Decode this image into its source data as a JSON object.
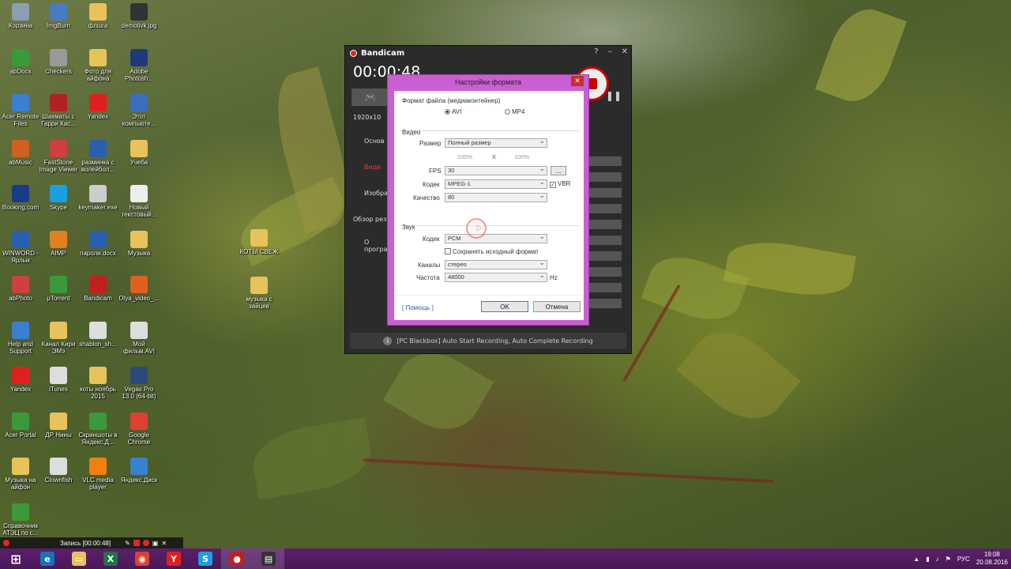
{
  "desktop_icons": [
    {
      "label": "Корзина",
      "icon": "recycle-bin-icon",
      "color": "#8aa0b0"
    },
    {
      "label": "ImgBurn",
      "icon": "imgburn-icon",
      "color": "#4a7bbf"
    },
    {
      "label": "флшга",
      "icon": "folder-icon",
      "color": "#e8c25a"
    },
    {
      "label": "demotivk.jpg",
      "icon": "image-file-icon",
      "color": "#333333"
    },
    {
      "label": "abDocs",
      "icon": "app-icon",
      "color": "#3a9a3a"
    },
    {
      "label": "Checkers",
      "icon": "checkers-icon",
      "color": "#999999"
    },
    {
      "label": "Фото для айфона",
      "icon": "folder-icon",
      "color": "#e8c25a"
    },
    {
      "label": "Adobe Photosh...",
      "icon": "photoshop-icon",
      "color": "#1e3a7a"
    },
    {
      "label": "Acer Remote Files",
      "icon": "acer-remote-icon",
      "color": "#3a7fd0"
    },
    {
      "label": "Шахматы с Гарри Кас...",
      "icon": "chess-icon",
      "color": "#b22222"
    },
    {
      "label": "Yandex",
      "icon": "yandex-icon",
      "color": "#e02020"
    },
    {
      "label": "Этот компьюте...",
      "icon": "computer-icon",
      "color": "#3a6fc0"
    },
    {
      "label": "abMusic",
      "icon": "music-app-icon",
      "color": "#d06020"
    },
    {
      "label": "FastStone Image Viewer",
      "icon": "faststone-icon",
      "color": "#d04040"
    },
    {
      "label": "разминка с волейбол...",
      "icon": "word-doc-icon",
      "color": "#2a5fb0"
    },
    {
      "label": "Учеба",
      "icon": "folder-icon",
      "color": "#e8c25a"
    },
    {
      "label": "Booking.com",
      "icon": "booking-icon",
      "color": "#1a3a8a"
    },
    {
      "label": "Skype",
      "icon": "skype-icon",
      "color": "#1aa0e0"
    },
    {
      "label": "keymaker.exe",
      "icon": "keymaker-icon",
      "color": "#cccccc"
    },
    {
      "label": "Новый текстовый...",
      "icon": "text-file-icon",
      "color": "#eeeeee"
    },
    {
      "label": "WINWORD - Ярлык",
      "icon": "word-icon",
      "color": "#2a5fb0"
    },
    {
      "label": "AIMP",
      "icon": "aimp-icon",
      "color": "#e08020"
    },
    {
      "label": "пароли.docx",
      "icon": "word-doc-icon",
      "color": "#2a5fb0"
    },
    {
      "label": "Музыка",
      "icon": "folder-icon",
      "color": "#e8c25a"
    },
    {
      "label": "abPhoto",
      "icon": "photo-app-icon",
      "color": "#d04040"
    },
    {
      "label": "µTorrent",
      "icon": "utorrent-icon",
      "color": "#3a9a3a"
    },
    {
      "label": "Bandicam",
      "icon": "bandicam-icon",
      "color": "#c02020"
    },
    {
      "label": "Dlya_video_...",
      "icon": "video-file-icon",
      "color": "#e06020"
    },
    {
      "label": "Help and Support",
      "icon": "help-icon",
      "color": "#3a7fd0"
    },
    {
      "label": "Канал Кири ЭМэ",
      "icon": "folder-icon",
      "color": "#e8c25a"
    },
    {
      "label": "shablon_sh...",
      "icon": "file-icon",
      "color": "#dddddd"
    },
    {
      "label": "Мой фильм.AVI",
      "icon": "avi-file-icon",
      "color": "#dddddd"
    },
    {
      "label": "Yandex",
      "icon": "yandex-icon",
      "color": "#e02020"
    },
    {
      "label": "iTunes",
      "icon": "itunes-icon",
      "color": "#dddddd"
    },
    {
      "label": "коты ноябрь 2015",
      "icon": "folder-icon",
      "color": "#e8c25a"
    },
    {
      "label": "Vegas Pro 13.0 (64-bit)",
      "icon": "vegas-icon",
      "color": "#2a4a7a"
    },
    {
      "label": "Acer Portal",
      "icon": "acer-portal-icon",
      "color": "#3a9a3a"
    },
    {
      "label": "ДР Нины",
      "icon": "folder-icon",
      "color": "#e8c25a"
    },
    {
      "label": "Скриншоты в Яндекс.Д...",
      "icon": "yandex-disk-icon",
      "color": "#3a9a3a"
    },
    {
      "label": "Google Chrome",
      "icon": "chrome-icon",
      "color": "#e04030"
    },
    {
      "label": "Музыка на айфон",
      "icon": "folder-icon",
      "color": "#e8c25a"
    },
    {
      "label": "Clownfish",
      "icon": "clownfish-icon",
      "color": "#dddddd"
    },
    {
      "label": "VLC media player",
      "icon": "vlc-icon",
      "color": "#f08010"
    },
    {
      "label": "Яндекс.Диск",
      "icon": "yandex-disk-icon",
      "color": "#3a7fd0"
    },
    {
      "label": "Справочник АТЭЦ по с...",
      "icon": "reference-icon",
      "color": "#3a9a3a"
    }
  ],
  "extra_icons": [
    {
      "label": "КОТЫ СВЕЖ",
      "icon": "folder-icon",
      "color": "#e8c25a"
    },
    {
      "label": "музыка с зайцев",
      "icon": "folder-icon",
      "color": "#e8c25a"
    }
  ],
  "bandicam": {
    "title": "Bandicam",
    "help": "?",
    "minimize": "–",
    "close": "✕",
    "timer": "00:00:48",
    "resolution": "1920x10",
    "sidebar": [
      "Основ",
      "Виде",
      "Изображ",
      "Обзор резу",
      "О програ"
    ],
    "footer": "[PC Blackbox] Auto Start Recording, Auto Complete Recording"
  },
  "dialog": {
    "title": "Настройки формата",
    "close": "✕",
    "container_label": "Формат файла (медиаконтейнер)",
    "avi_label": "AVI",
    "mp4_label": "MP4",
    "video_section": "Видео",
    "size_label": "Размер",
    "size_value": "Полный размер",
    "width_pct": "100%",
    "x_label": "X",
    "height_pct": "100%",
    "fps_label": "FPS",
    "fps_value": "30",
    "fps_more": "...",
    "codec_label": "Кодек",
    "codec_value": "MPEG-1",
    "vbr_label": "VBR",
    "quality_label": "Качество",
    "quality_value": "80",
    "audio_section": "Звук",
    "audio_codec_label": "Кодек",
    "audio_codec_value": "PCM",
    "keep_format_label": "Сохранять исходный формат",
    "channels_label": "Каналы",
    "channels_value": "стерео",
    "freq_label": "Частота",
    "freq_value": "48000",
    "hz_label": "Hz",
    "help_link": "[ Помощь ]",
    "ok_label": "OK",
    "cancel_label": "Отмена"
  },
  "record_bar": {
    "label": "Запись [00:00:48]"
  },
  "taskbar": {
    "apps": [
      {
        "name": "start",
        "icon": "windows-logo-icon",
        "color": "transparent",
        "glyph": "⊞"
      },
      {
        "name": "ie",
        "icon": "internet-explorer-icon",
        "color": "#1a70c0",
        "glyph": "e"
      },
      {
        "name": "explorer",
        "icon": "file-explorer-icon",
        "color": "#e8c25a",
        "glyph": "▭"
      },
      {
        "name": "excel",
        "icon": "excel-icon",
        "color": "#217346",
        "glyph": "X"
      },
      {
        "name": "chrome",
        "icon": "chrome-icon",
        "color": "#e04030",
        "glyph": "◉"
      },
      {
        "name": "yandex",
        "icon": "yandex-icon",
        "color": "#e02020",
        "glyph": "Y"
      },
      {
        "name": "skype",
        "icon": "skype-icon",
        "color": "#1aa0e0",
        "glyph": "S"
      },
      {
        "name": "bandicam",
        "icon": "bandicam-icon",
        "color": "#c02020",
        "glyph": "●"
      },
      {
        "name": "vegas",
        "icon": "vegas-icon",
        "color": "#333333",
        "glyph": "▤"
      }
    ],
    "lang": "РУС",
    "time": "19:08",
    "date": "20.08.2016"
  }
}
